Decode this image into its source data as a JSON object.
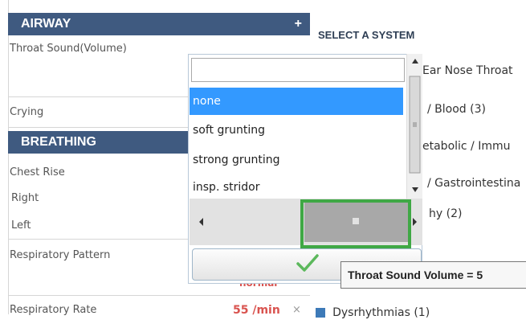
{
  "airway": {
    "title": "AIRWAY",
    "add_symbol": "+",
    "throat_sound_label": "Throat Sound(Volume)",
    "crying_label": "Crying"
  },
  "breathing": {
    "title": "BREATHING",
    "chest_rise_label": "Chest Rise",
    "right_label": "Right",
    "left_label": "Left",
    "respiratory_pattern_label": "Respiratory Pattern",
    "respiratory_rate_label": "Respiratory Rate",
    "respiratory_rate_value": "55 /min",
    "clear_symbol": "×",
    "obscured_value": "normal"
  },
  "systems": {
    "title": "SELECT A SYSTEM",
    "items": [
      "Ear Nose Throat",
      "/ Blood (3)",
      "etabolic / Immu",
      "/ Gastrointestina",
      "hy (2)"
    ],
    "bottom_item": "Dysrhythmias (1)",
    "bottom_item_color": "#3d7ab8"
  },
  "dropdown": {
    "input_value": "",
    "options": [
      "none",
      "soft grunting",
      "strong grunting",
      "insp. stridor"
    ],
    "selected_index": 0,
    "selected_color": "#3399ff",
    "confirm_icon": "checkmark-icon",
    "confirm_color": "#5cb85c",
    "highlight_color": "#3fa845"
  },
  "tooltip": {
    "text": "Throat Sound Volume = 5"
  },
  "colors": {
    "header_bg": "#3f5a80",
    "rate_value": "#d9534f"
  }
}
